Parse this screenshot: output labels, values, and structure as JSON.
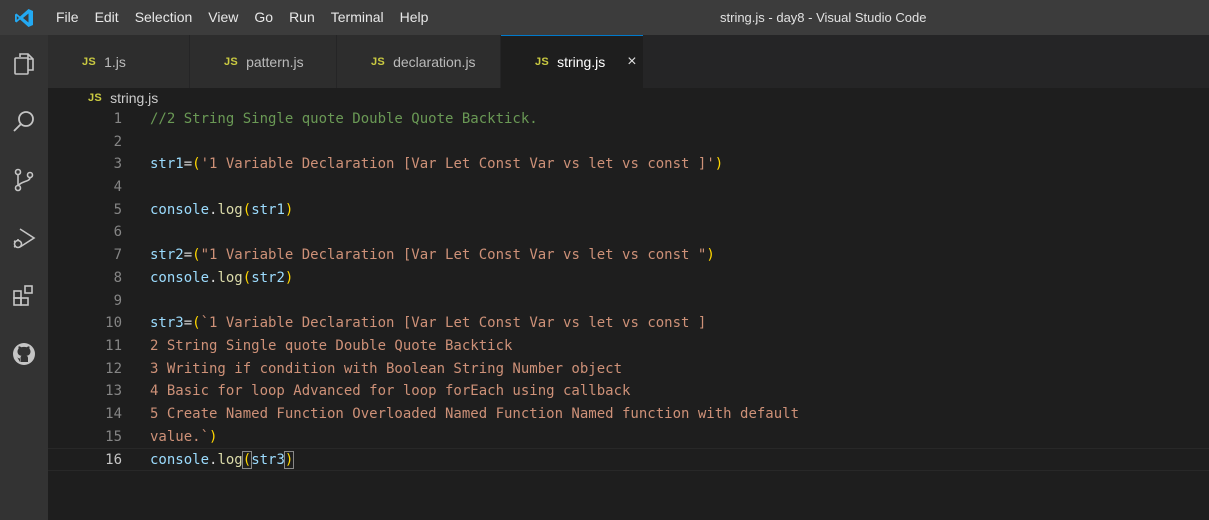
{
  "window": {
    "title": "string.js - day8 - Visual Studio Code"
  },
  "menu": [
    "File",
    "Edit",
    "Selection",
    "View",
    "Go",
    "Run",
    "Terminal",
    "Help"
  ],
  "activity_bar": [
    "explorer-icon",
    "search-icon",
    "source-control-icon",
    "run-debug-icon",
    "extensions-icon",
    "github-icon"
  ],
  "tabs": [
    {
      "badge": "JS",
      "label": "1.js",
      "active": false
    },
    {
      "badge": "JS",
      "label": "pattern.js",
      "active": false
    },
    {
      "badge": "JS",
      "label": "declaration.js",
      "active": false
    },
    {
      "badge": "JS",
      "label": "string.js",
      "active": true,
      "close": "×"
    }
  ],
  "breadcrumb": {
    "badge": "JS",
    "label": "string.js"
  },
  "editor": {
    "current_line": 16,
    "lines": [
      {
        "n": "1",
        "parts": [
          [
            "comment",
            "//2 String Single quote Double Quote Backtick."
          ]
        ]
      },
      {
        "n": "2",
        "parts": []
      },
      {
        "n": "3",
        "parts": [
          [
            "var",
            "str1"
          ],
          [
            "plain",
            "="
          ],
          [
            "paren",
            "("
          ],
          [
            "str",
            "'1 Variable Declaration [Var Let Const Var vs let vs const ]'"
          ],
          [
            "paren",
            ")"
          ]
        ]
      },
      {
        "n": "4",
        "parts": []
      },
      {
        "n": "5",
        "parts": [
          [
            "var",
            "console"
          ],
          [
            "plain",
            "."
          ],
          [
            "fn",
            "log"
          ],
          [
            "paren",
            "("
          ],
          [
            "var",
            "str1"
          ],
          [
            "paren",
            ")"
          ]
        ]
      },
      {
        "n": "6",
        "parts": []
      },
      {
        "n": "7",
        "parts": [
          [
            "var",
            "str2"
          ],
          [
            "plain",
            "="
          ],
          [
            "paren",
            "("
          ],
          [
            "str",
            "\"1 Variable Declaration [Var Let Const Var vs let vs const \""
          ],
          [
            "paren",
            ")"
          ]
        ]
      },
      {
        "n": "8",
        "parts": [
          [
            "var",
            "console"
          ],
          [
            "plain",
            "."
          ],
          [
            "fn",
            "log"
          ],
          [
            "paren",
            "("
          ],
          [
            "var",
            "str2"
          ],
          [
            "paren",
            ")"
          ]
        ]
      },
      {
        "n": "9",
        "parts": []
      },
      {
        "n": "10",
        "parts": [
          [
            "var",
            "str3"
          ],
          [
            "plain",
            "="
          ],
          [
            "paren",
            "("
          ],
          [
            "str",
            "`1 Variable Declaration [Var Let Const Var vs let vs const ]"
          ]
        ]
      },
      {
        "n": "11",
        "parts": [
          [
            "str",
            "2 String Single quote Double Quote Backtick"
          ]
        ]
      },
      {
        "n": "12",
        "parts": [
          [
            "str",
            "3 Writing if condition with Boolean String Number object"
          ]
        ]
      },
      {
        "n": "13",
        "parts": [
          [
            "str",
            "4 Basic for loop Advanced for loop forEach using callback"
          ]
        ]
      },
      {
        "n": "14",
        "parts": [
          [
            "str",
            "5 Create Named Function Overloaded Named Function Named function with default"
          ]
        ]
      },
      {
        "n": "15",
        "parts": [
          [
            "str",
            "value.`"
          ],
          [
            "paren",
            ")"
          ]
        ]
      },
      {
        "n": "16",
        "parts": [
          [
            "var",
            "console"
          ],
          [
            "plain",
            "."
          ],
          [
            "fn",
            "log"
          ],
          [
            "paren",
            "("
          ],
          [
            "var",
            "str3"
          ],
          [
            "paren",
            ")"
          ]
        ]
      }
    ]
  },
  "colors": {
    "accent": "#007acc",
    "js_badge": "#cbcb41",
    "comment": "#6a9955",
    "string": "#ce9178",
    "variable": "#9cdcfe",
    "function": "#dcdcaa",
    "bracket": "#ffd700"
  }
}
